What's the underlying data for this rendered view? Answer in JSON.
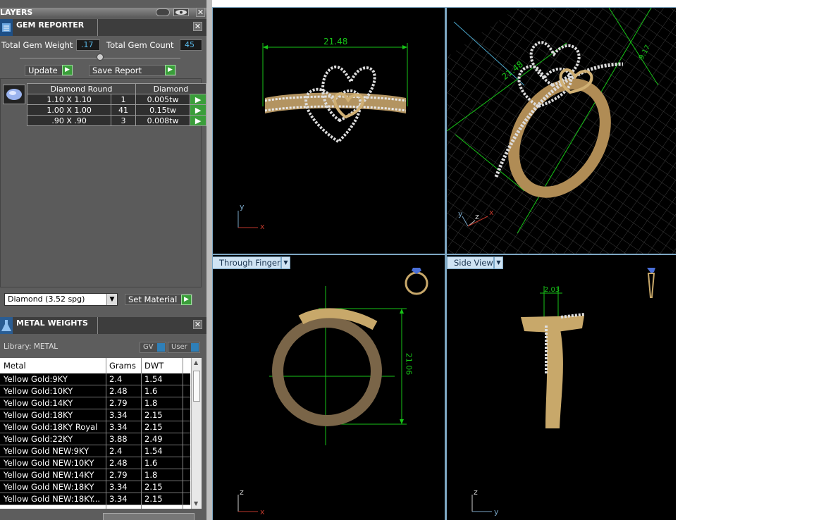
{
  "layers": {
    "title": "LAYERS"
  },
  "gem_reporter": {
    "title": "GEM REPORTER",
    "total_weight_label": "Total Gem Weight",
    "total_weight_value": ".17",
    "total_count_label": "Total Gem Count",
    "total_count_value": "45",
    "update_label": "Update",
    "save_report_label": "Save Report",
    "table_headers": [
      "Diamond Round",
      "Diamond"
    ],
    "rows": [
      {
        "size": "1.10 X 1.10",
        "count": "1",
        "weight": "0.005tw"
      },
      {
        "size": "1.00 X 1.00",
        "count": "41",
        "weight": "0.15tw"
      },
      {
        "size": ".90 X .90",
        "count": "3",
        "weight": "0.008tw"
      }
    ],
    "material_select": "Diamond    (3.52 spg)",
    "set_material_label": "Set Material"
  },
  "metal_weights": {
    "title": "METAL WEIGHTS",
    "library_label": "Library: METAL",
    "gv_label": "GV",
    "user_label": "User",
    "headers": [
      "Metal",
      "Grams",
      "DWT"
    ],
    "rows": [
      {
        "metal": "Yellow Gold:9KY",
        "grams": "2.4",
        "dwt": "1.54"
      },
      {
        "metal": "Yellow Gold:10KY",
        "grams": "2.48",
        "dwt": "1.6"
      },
      {
        "metal": "Yellow Gold:14KY",
        "grams": "2.79",
        "dwt": "1.8"
      },
      {
        "metal": "Yellow Gold:18KY",
        "grams": "3.34",
        "dwt": "2.15"
      },
      {
        "metal": "Yellow Gold:18KY Royal",
        "grams": "3.34",
        "dwt": "2.15"
      },
      {
        "metal": "Yellow Gold:22KY",
        "grams": "3.88",
        "dwt": "2.49"
      },
      {
        "metal": "Yellow Gold NEW:9KY",
        "grams": "2.4",
        "dwt": "1.54"
      },
      {
        "metal": "Yellow Gold NEW:10KY",
        "grams": "2.48",
        "dwt": "1.6"
      },
      {
        "metal": "Yellow Gold NEW:14KY",
        "grams": "2.79",
        "dwt": "1.8"
      },
      {
        "metal": "Yellow Gold NEW:18KY",
        "grams": "3.34",
        "dwt": "2.15"
      },
      {
        "metal": "Yellow Gold NEW:18KY...",
        "grams": "3.34",
        "dwt": "2.15"
      }
    ]
  },
  "viewports": {
    "top": {
      "dimension": "21.48"
    },
    "perspective": {
      "dimension_a": "21.48",
      "dimension_b": "9.17"
    },
    "through_finger": {
      "label": "Through Finger",
      "dimension": "21.06"
    },
    "side_view": {
      "label": "Side View",
      "dimension": "2.03"
    }
  },
  "axes": {
    "x": "x",
    "y": "y",
    "z": "z"
  },
  "colors": {
    "viewport_bg": "#000000",
    "panel_bg": "#5d5d5d",
    "accent_green": "#3a9e3a",
    "dimension_green": "#17c417",
    "gold": "#c8a86a",
    "value_blue": "#58b8e8"
  }
}
